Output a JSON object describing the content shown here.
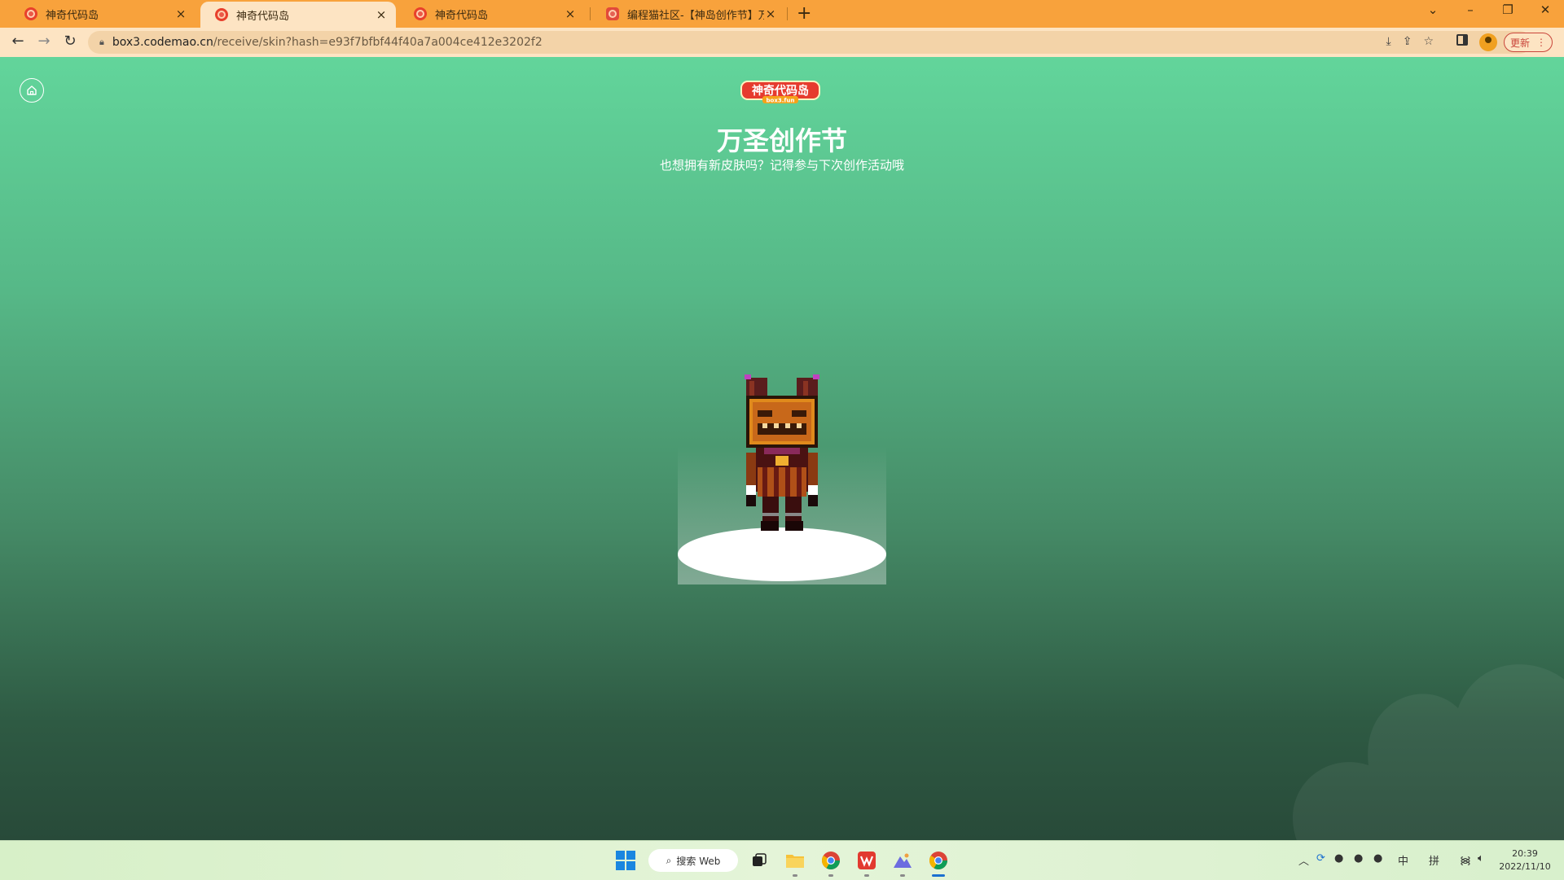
{
  "browser": {
    "tabs": [
      {
        "title": "神奇代码岛",
        "close": "×"
      },
      {
        "title": "神奇代码岛",
        "close": "×"
      },
      {
        "title": "神奇代码岛",
        "close": "×"
      },
      {
        "title": "编程猫社区-【神岛创作节】万圣",
        "close": "×"
      }
    ],
    "new_tab": "+",
    "url_host": "box3.codemao.cn",
    "url_path": "/receive/skin?hash=e93f7bfbf44f40a7a004ce412e3202f2",
    "update_label": "更新"
  },
  "page": {
    "logo_text": "神奇代码岛",
    "logo_sub": "box3.fun",
    "title": "万圣创作节",
    "subtitle": "也想拥有新皮肤吗？记得参与下次创作活动哦"
  },
  "taskbar": {
    "search_label": "搜索 Web",
    "ime_lang": "中",
    "ime_mode": "拼",
    "time": "20:39",
    "date": "2022/11/10"
  },
  "colors": {
    "tab_strip": "#f8a23c",
    "toolbar": "#fde4c3",
    "page_top": "#62d59b",
    "page_bottom": "#284a39"
  }
}
